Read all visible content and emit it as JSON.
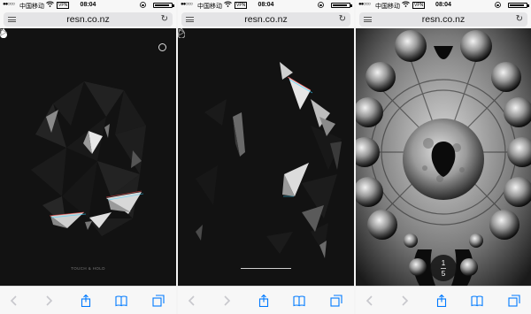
{
  "status_bar": {
    "signal": "●●○○○",
    "carrier": "中国移动",
    "vpn": "VPN",
    "time": "08:04",
    "battery_level": 0.9
  },
  "browser": {
    "url": "resn.co.nz"
  },
  "screens": [
    {
      "hint": "TOUCH & HOLD"
    },
    {
      "loading": ""
    },
    {
      "counter_current": "1",
      "counter_total": "5"
    }
  ],
  "colors": {
    "accent_blue": "#007aff",
    "canvas_bg": "#121212"
  },
  "icons": {
    "menu": "menu-icon",
    "reload": "reload-icon",
    "drop": "drop-icon",
    "circle": "circle-icon",
    "play": "play-icon",
    "back": "chevron-left-icon",
    "forward": "chevron-right-icon",
    "share": "share-icon",
    "bookmarks": "book-icon",
    "tabs": "tabs-icon"
  }
}
